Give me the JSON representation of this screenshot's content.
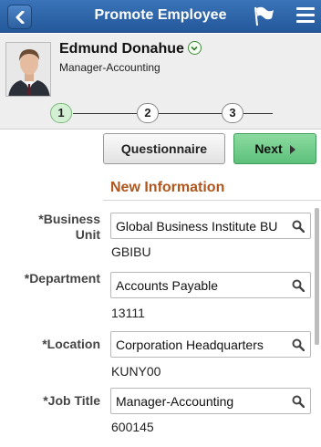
{
  "header": {
    "title": "Promote Employee",
    "back_icon": "back-arrow-icon",
    "flag_icon": "flag-icon",
    "menu_icon": "hamburger-menu-icon"
  },
  "employee": {
    "name": "Edmund Donahue",
    "job": "Manager-Accounting",
    "expand_icon": "chevron-down-circle-icon"
  },
  "steps": [
    "1",
    "2",
    "3"
  ],
  "active_step": "1",
  "buttons": {
    "questionnaire": "Questionnaire",
    "next": "Next"
  },
  "section": {
    "title": "New Information"
  },
  "fields": [
    {
      "label_line1": "*Business",
      "label_line2": "Unit",
      "value": "Global Business Institute BU",
      "code": "GBIBU"
    },
    {
      "label_line1": "*Department",
      "label_line2": "",
      "value": "Accounts Payable",
      "code": "13111"
    },
    {
      "label_line1": "*Location",
      "label_line2": "",
      "value": "Corporation Headquarters",
      "code": "KUNY00"
    },
    {
      "label_line1": "*Job Title",
      "label_line2": "",
      "value": "Manager-Accounting",
      "code": "600145"
    }
  ],
  "colors": {
    "header": "#2f66aa",
    "next_button": "#6dcb88",
    "section_title": "#b0561c"
  }
}
